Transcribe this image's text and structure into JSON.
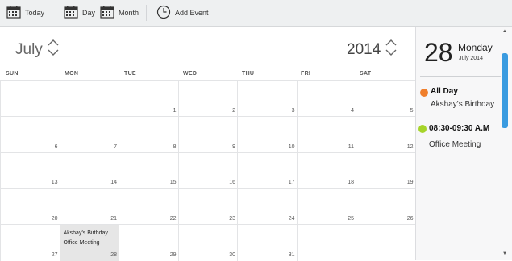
{
  "toolbar": {
    "today_label": "Today",
    "day_label": "Day",
    "month_label": "Month",
    "add_event_label": "Add Event"
  },
  "nav": {
    "month": "July",
    "year": "2014"
  },
  "weekdays": [
    "SUN",
    "MON",
    "TUE",
    "WED",
    "THU",
    "FRI",
    "SAT"
  ],
  "weeks": [
    [
      "",
      "",
      "1",
      "2",
      "3",
      "4",
      "5"
    ],
    [
      "6",
      "7",
      "8",
      "9",
      "10",
      "11",
      "12"
    ],
    [
      "13",
      "14",
      "15",
      "16",
      "17",
      "18",
      "19"
    ],
    [
      "20",
      "21",
      "22",
      "23",
      "24",
      "25",
      "26"
    ],
    [
      "27",
      "28",
      "29",
      "30",
      "31",
      "",
      ""
    ]
  ],
  "calendar_event": {
    "line1": "Akshay's Birthday",
    "line2": "Office Meeting",
    "highlight_day": "28"
  },
  "side": {
    "day": "28",
    "weekday": "Monday",
    "month_year": "July 2014",
    "events": [
      {
        "time": "All Day",
        "title": "Akshay's Birthday",
        "color": "#f07f2c"
      },
      {
        "time": "08:30-09:30 A.M",
        "title": "Office Meeting",
        "color": "#a6d42a"
      }
    ]
  },
  "colors": {
    "accent": "#3a9be0",
    "toolbar_bg": "#eef0f1"
  }
}
